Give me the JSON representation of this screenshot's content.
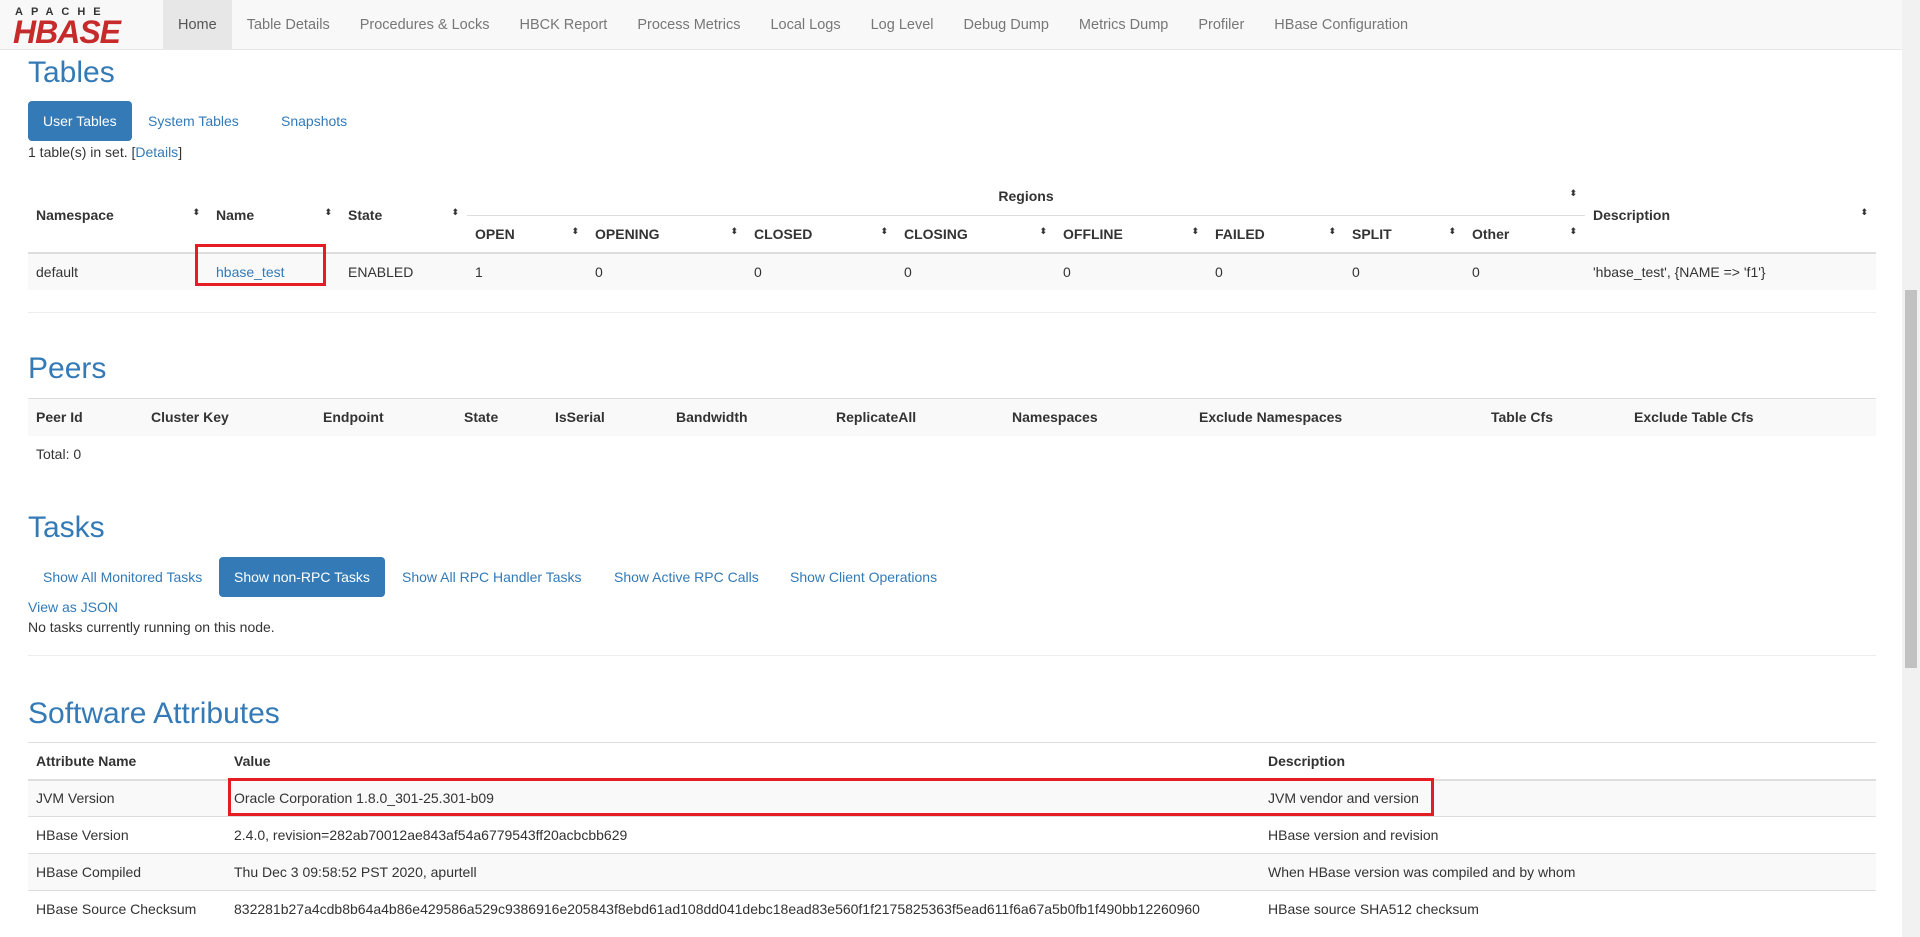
{
  "logo": {
    "top": "APACHE",
    "main": "HBASE"
  },
  "nav": [
    "Home",
    "Table Details",
    "Procedures & Locks",
    "HBCK Report",
    "Process Metrics",
    "Local Logs",
    "Log Level",
    "Debug Dump",
    "Metrics Dump",
    "Profiler",
    "HBase Configuration"
  ],
  "tables": {
    "title": "Tables",
    "tabs": [
      "User Tables",
      "System Tables",
      "Snapshots"
    ],
    "summary_prefix": "1 table(s) in set. [",
    "summary_link": "Details",
    "summary_suffix": "]",
    "headers": {
      "namespace": "Namespace",
      "name": "Name",
      "state": "State",
      "regions": "Regions",
      "description": "Description"
    },
    "region_headers": [
      "OPEN",
      "OPENING",
      "CLOSED",
      "CLOSING",
      "OFFLINE",
      "FAILED",
      "SPLIT",
      "Other"
    ],
    "row": {
      "namespace": "default",
      "name": "hbase_test",
      "state": "ENABLED",
      "regions": [
        "1",
        "0",
        "0",
        "0",
        "0",
        "0",
        "0",
        "0"
      ],
      "description": "'hbase_test', {NAME => 'f1'}"
    }
  },
  "peers": {
    "title": "Peers",
    "headers": [
      "Peer Id",
      "Cluster Key",
      "Endpoint",
      "State",
      "IsSerial",
      "Bandwidth",
      "ReplicateAll",
      "Namespaces",
      "Exclude Namespaces",
      "Table Cfs",
      "Exclude Table Cfs"
    ],
    "total": "Total: 0"
  },
  "tasks": {
    "title": "Tasks",
    "tabs": [
      "Show All Monitored Tasks",
      "Show non-RPC Tasks",
      "Show All RPC Handler Tasks",
      "Show Active RPC Calls",
      "Show Client Operations"
    ],
    "json_link": "View as JSON",
    "status": "No tasks currently running on this node."
  },
  "software": {
    "title": "Software Attributes",
    "headers": [
      "Attribute Name",
      "Value",
      "Description"
    ],
    "rows": [
      [
        "JVM Version",
        "Oracle Corporation 1.8.0_301-25.301-b09",
        "JVM vendor and version"
      ],
      [
        "HBase Version",
        "2.4.0, revision=282ab70012ae843af54a6779543ff20acbcbb629",
        "HBase version and revision"
      ],
      [
        "HBase Compiled",
        "Thu Dec 3 09:58:52 PST 2020, apurtell",
        "When HBase version was compiled and by whom"
      ],
      [
        "HBase Source Checksum",
        "832281b27a4cdb8b64a4b86e429586a529c9386916e205843f8ebd61ad108dd041debc18ead83e560f1f2175825363f5ead611f6a67a5b0fb1f490bb12260960",
        "HBase source SHA512 checksum"
      ]
    ]
  },
  "colors": {
    "accent": "#337ab7",
    "highlight": "#e51c23",
    "brand": "#c62a2a"
  }
}
